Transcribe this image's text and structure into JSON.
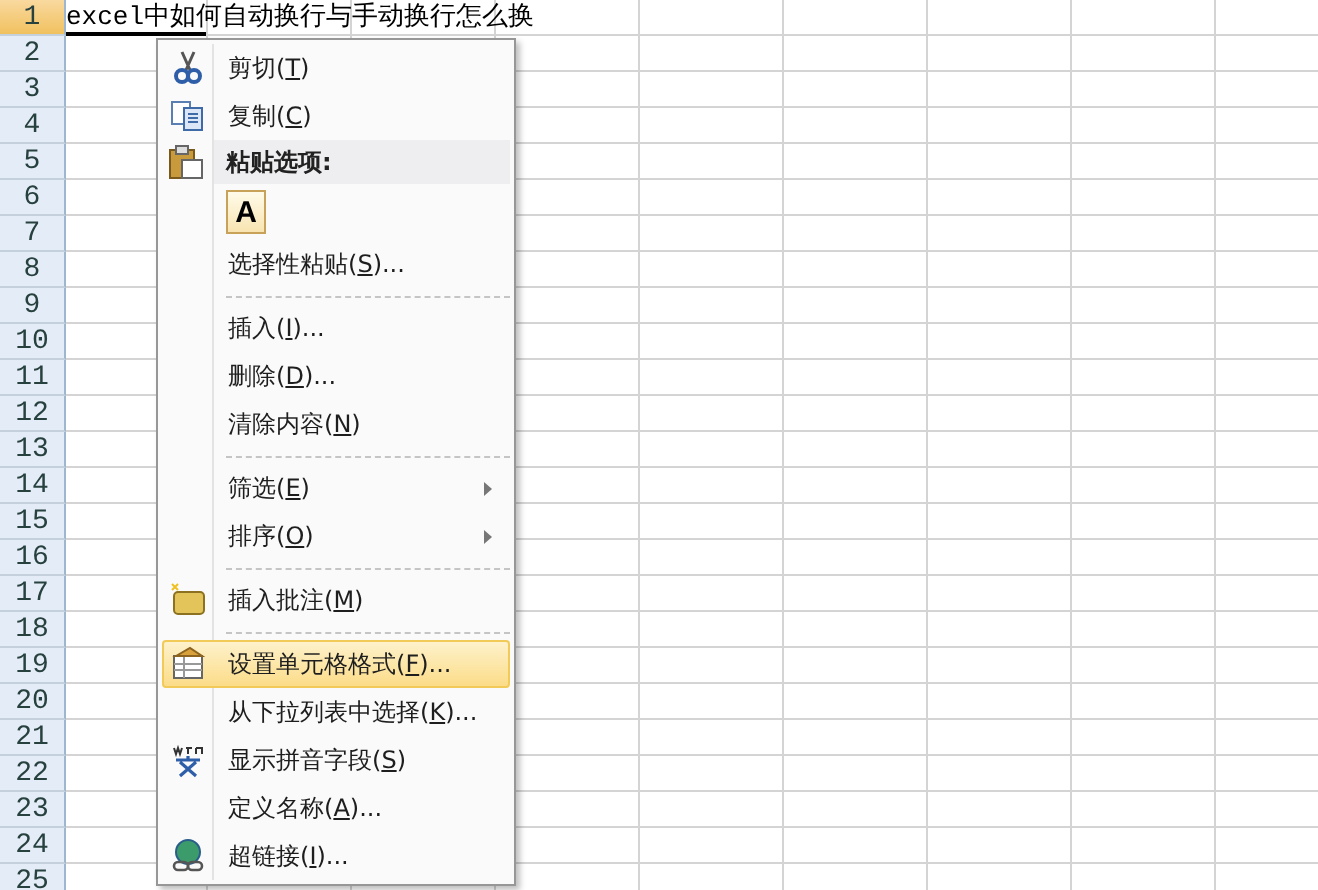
{
  "sheet": {
    "rows": [
      {
        "label": "1",
        "selected": true
      },
      {
        "label": "2",
        "selected": false
      },
      {
        "label": "3",
        "selected": false
      },
      {
        "label": "4",
        "selected": false
      },
      {
        "label": "5",
        "selected": false
      },
      {
        "label": "6",
        "selected": false
      },
      {
        "label": "7",
        "selected": false
      },
      {
        "label": "8",
        "selected": false
      },
      {
        "label": "9",
        "selected": false
      },
      {
        "label": "10",
        "selected": false
      },
      {
        "label": "11",
        "selected": false
      },
      {
        "label": "12",
        "selected": false
      },
      {
        "label": "13",
        "selected": false
      },
      {
        "label": "14",
        "selected": false
      },
      {
        "label": "15",
        "selected": false
      },
      {
        "label": "16",
        "selected": false
      },
      {
        "label": "17",
        "selected": false
      },
      {
        "label": "18",
        "selected": false
      },
      {
        "label": "19",
        "selected": false
      },
      {
        "label": "20",
        "selected": false
      },
      {
        "label": "21",
        "selected": false
      },
      {
        "label": "22",
        "selected": false
      },
      {
        "label": "23",
        "selected": false
      },
      {
        "label": "24",
        "selected": false
      },
      {
        "label": "25",
        "selected": false
      }
    ],
    "cell_a1": "excel中如何自动换行与手动换行怎么换"
  },
  "context_menu": {
    "items": [
      {
        "kind": "command",
        "pre": "剪切(",
        "key": "T",
        "post": ")",
        "submenu": false,
        "selected": false
      },
      {
        "kind": "command",
        "pre": "复制(",
        "key": "C",
        "post": ")",
        "submenu": false,
        "selected": false
      },
      {
        "kind": "header",
        "text": "粘贴选项:"
      },
      {
        "kind": "paste-options",
        "text": "A"
      },
      {
        "kind": "command",
        "pre": "选择性粘贴(",
        "key": "S",
        "post": ")...",
        "submenu": false,
        "selected": false
      },
      {
        "kind": "separator"
      },
      {
        "kind": "command",
        "pre": "插入(",
        "key": "I",
        "post": ")...",
        "submenu": false,
        "selected": false
      },
      {
        "kind": "command",
        "pre": "删除(",
        "key": "D",
        "post": ")...",
        "submenu": false,
        "selected": false
      },
      {
        "kind": "command",
        "pre": "清除内容(",
        "key": "N",
        "post": ")",
        "submenu": false,
        "selected": false
      },
      {
        "kind": "separator"
      },
      {
        "kind": "command",
        "pre": "筛选(",
        "key": "E",
        "post": ")",
        "submenu": true,
        "selected": false
      },
      {
        "kind": "command",
        "pre": "排序(",
        "key": "O",
        "post": ")",
        "submenu": true,
        "selected": false
      },
      {
        "kind": "separator"
      },
      {
        "kind": "command",
        "pre": "插入批注(",
        "key": "M",
        "post": ")",
        "submenu": false,
        "selected": false
      },
      {
        "kind": "separator"
      },
      {
        "kind": "command",
        "pre": "设置单元格格式(",
        "key": "F",
        "post": ")...",
        "submenu": false,
        "selected": true
      },
      {
        "kind": "command",
        "pre": "从下拉列表中选择(",
        "key": "K",
        "post": ")...",
        "submenu": false,
        "selected": false
      },
      {
        "kind": "command",
        "pre": "显示拼音字段(",
        "key": "S",
        "post": ")",
        "submenu": false,
        "selected": false
      },
      {
        "kind": "command",
        "pre": "定义名称(",
        "key": "A",
        "post": ")...",
        "submenu": false,
        "selected": false
      },
      {
        "kind": "command",
        "pre": "超链接(",
        "key": "I",
        "post": ")...",
        "submenu": false,
        "selected": false
      }
    ]
  }
}
